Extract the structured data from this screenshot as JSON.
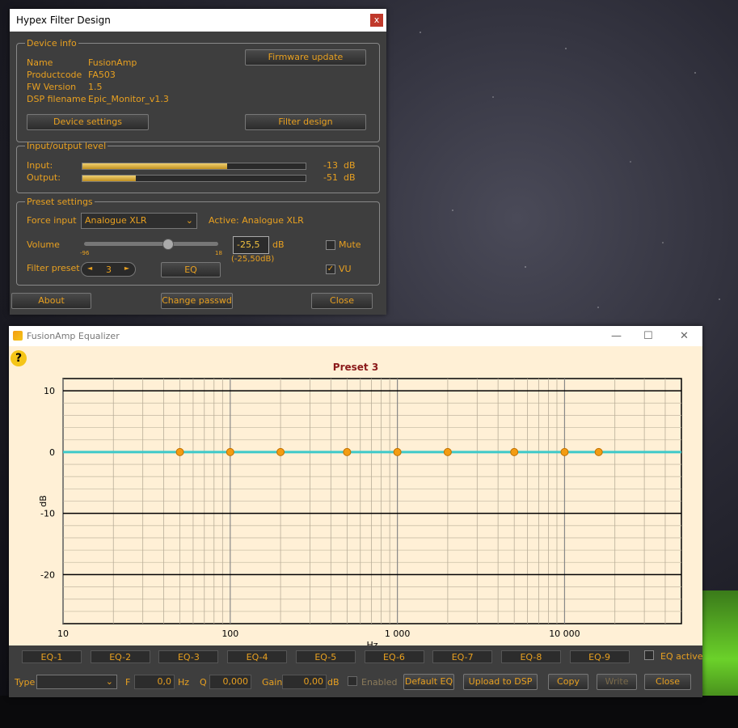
{
  "hypex": {
    "title": "Hypex Filter Design",
    "close_glyph": "x",
    "device_info": {
      "legend": "Device info",
      "name_label": "Name",
      "name_value": "FusionAmp",
      "productcode_label": "Productcode",
      "productcode_value": "FA503",
      "fw_label": "FW Version",
      "fw_value": "1.5",
      "dsp_label": "DSP filename",
      "dsp_value": "Epic_Monitor_v1.3",
      "firmware_update": "Firmware update",
      "device_settings": "Device settings",
      "filter_design": "Filter design"
    },
    "io": {
      "legend": "Input/output level",
      "input_label": "Input:",
      "input_value": "-13",
      "input_unit": "dB",
      "input_level": 0.65,
      "output_label": "Output:",
      "output_value": "-51",
      "output_unit": "dB",
      "output_level": 0.24
    },
    "preset": {
      "legend": "Preset settings",
      "force_input_label": "Force input",
      "force_input_value": "Analogue XLR",
      "active_text": "Active: Analogue XLR",
      "volume_label": "Volume",
      "slider_min": "-96",
      "slider_max": "18",
      "volume_level": 0.62,
      "volume_value": "-25,5",
      "volume_unit": "dB",
      "volume_sub": "(-25,50dB)",
      "mute_label": "Mute",
      "vu_label": "VU",
      "vu_check": "✓",
      "filter_preset_label": "Filter preset",
      "filter_preset_value": "3",
      "prev": "◄",
      "next": "►",
      "eq_button": "EQ"
    },
    "about": "About",
    "change_passwd": "Change passwd",
    "close": "Close"
  },
  "eq": {
    "title": "FusionAmp Equalizer",
    "minimize": "—",
    "maximize": "☐",
    "close": "✕",
    "help": "?",
    "chart_data": {
      "type": "line",
      "title": "Preset 3",
      "xlabel": "Hz",
      "ylabel": "dB",
      "xscale": "log",
      "xlim": [
        10,
        50000
      ],
      "ylim": [
        -28,
        12
      ],
      "x_ticks": [
        10,
        100,
        1000,
        10000
      ],
      "x_tick_labels": [
        "10",
        "100",
        "1 000",
        "10 000"
      ],
      "y_ticks": [
        10,
        0,
        -10,
        -20
      ],
      "y_tick_labels": [
        "10",
        "0",
        "-10",
        "-20"
      ],
      "grid": true,
      "line_color": "#3ec9c9",
      "curve": {
        "x": [
          10,
          50000
        ],
        "y": [
          0,
          0
        ]
      },
      "eq_points": {
        "x": [
          50,
          100,
          200,
          500,
          1000,
          2000,
          5000,
          10000,
          16000
        ],
        "y": [
          0,
          0,
          0,
          0,
          0,
          0,
          0,
          0,
          0
        ]
      },
      "point_color": "#f39c12"
    },
    "bands": [
      "EQ-1",
      "EQ-2",
      "EQ-3",
      "EQ-4",
      "EQ-5",
      "EQ-6",
      "EQ-7",
      "EQ-8",
      "EQ-9"
    ],
    "eq_active_label": "EQ active",
    "type_label": "Type",
    "f_label": "F",
    "f_value": "0,0",
    "f_unit": "Hz",
    "q_label": "Q",
    "q_value": "0,000",
    "gain_label": "Gain",
    "gain_value": "0,00",
    "gain_unit": "dB",
    "enabled_label": "Enabled",
    "default_eq": "Default EQ",
    "upload": "Upload to DSP",
    "copy": "Copy",
    "write": "Write",
    "close_btn": "Close"
  }
}
